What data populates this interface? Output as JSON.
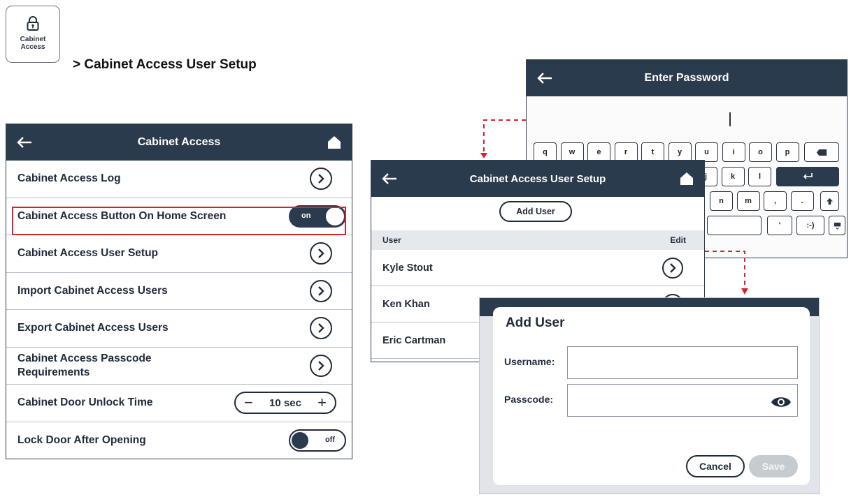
{
  "breadcrumb": {
    "icon_label": "Cabinet\nAccess",
    "icon_label_line1": "Cabinet",
    "icon_label_line2": "Access",
    "path": "> Cabinet Access User Setup"
  },
  "cabinet_access": {
    "title": "Cabinet Access",
    "rows": [
      {
        "label": "Cabinet Access Log",
        "control": "chevron"
      },
      {
        "label": "Cabinet Access Button On Home Screen",
        "control": "toggle",
        "value": "on"
      },
      {
        "label": "Cabinet Access User Setup",
        "control": "chevron",
        "highlighted": true
      },
      {
        "label": "Import Cabinet Access Users",
        "control": "chevron"
      },
      {
        "label": "Export Cabinet Access Users",
        "control": "chevron"
      },
      {
        "label": "Cabinet Access Passcode Requirements",
        "label_line1": "Cabinet Access Passcode",
        "label_line2": "Requirements",
        "control": "chevron"
      },
      {
        "label": "Cabinet Door Unlock Time",
        "control": "stepper",
        "value": "10 sec"
      },
      {
        "label": "Lock Door After Opening",
        "control": "toggle",
        "value": "off"
      }
    ]
  },
  "keyboard_screen": {
    "title": "Enter Password",
    "row1": [
      "q",
      "w",
      "e",
      "r",
      "t",
      "y",
      "u",
      "i",
      "o",
      "p"
    ],
    "row2": [
      "j",
      "k",
      "l"
    ],
    "row3": [
      "n",
      "m",
      ",",
      "."
    ],
    "row4": [
      "'",
      ":-)"
    ]
  },
  "user_setup": {
    "title": "Cabinet Access User Setup",
    "add_user_label": "Add User",
    "col_user": "User",
    "col_edit": "Edit",
    "users": [
      "Kyle Stout",
      "Ken Khan",
      "Eric Cartman"
    ]
  },
  "add_user_dialog": {
    "title": "Add User",
    "username_label": "Username:",
    "username_value": "",
    "passcode_label": "Passcode:",
    "passcode_value": "",
    "cancel_label": "Cancel",
    "save_label": "Save"
  },
  "colors": {
    "header": "#2a3b4d",
    "highlight": "#d4252e",
    "connector": "#d4252e",
    "save_disabled": "#c6cbd0"
  }
}
